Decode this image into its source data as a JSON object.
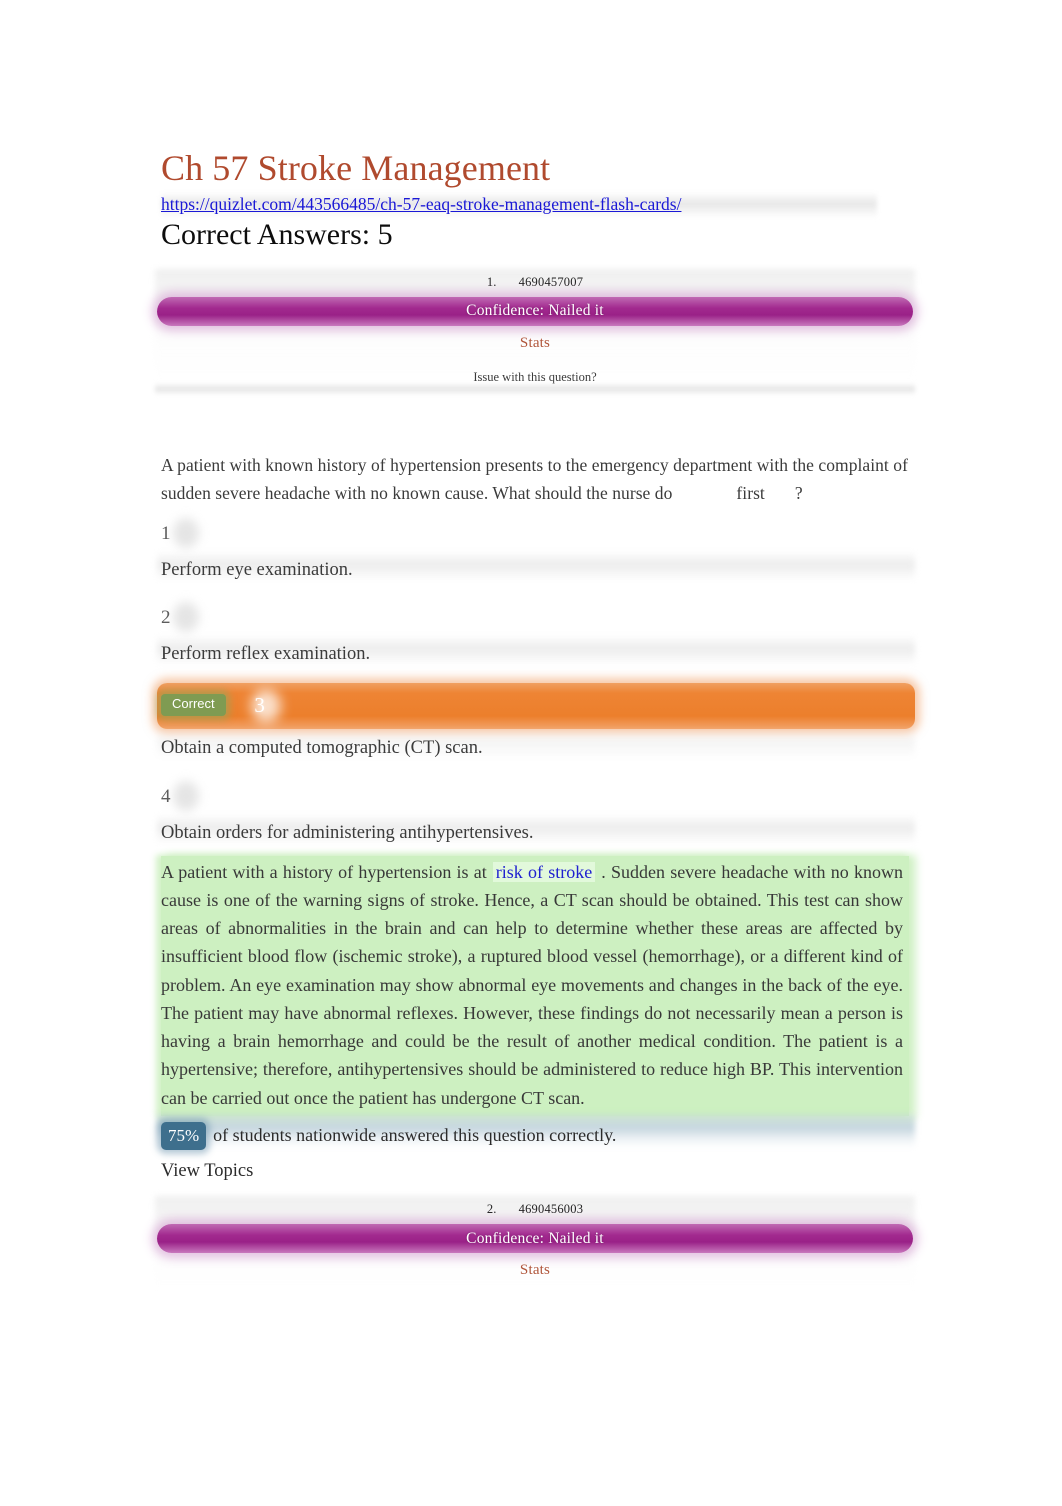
{
  "document": {
    "title": "Ch 57 Stroke Management",
    "url": "https://quizlet.com/443566485/ch-57-eaq-stroke-management-flash-cards/",
    "subtitle": "Correct Answers: 5",
    "title_color": "#b04a2e",
    "link_color": "#1a18d6"
  },
  "questions": [
    {
      "ordinal": "1.",
      "id": "4690457007",
      "confidence_label": "Confidence: Nailed it",
      "confidence_color": "#9a2187",
      "stats_link": "Stats",
      "issue_link": "Issue with this question?",
      "stem_part1": "A patient with known history of hypertension presents to the emergency department with the complaint of sudden severe headache with no known cause. What should the nurse do",
      "stem_emphasis": "first",
      "stem_part2": "?",
      "options": [
        {
          "number": "1",
          "text": "Perform eye examination.",
          "correct": false
        },
        {
          "number": "2",
          "text": "Perform reflex examination.",
          "correct": false
        },
        {
          "number": "3",
          "text": "Obtain a computed tomographic (CT) scan.",
          "correct": true,
          "badge": "Correct"
        },
        {
          "number": "4",
          "text": "Obtain orders for administering antihypertensives.",
          "correct": false
        }
      ],
      "rationale_part1": "A patient with a history of hypertension is at",
      "rationale_link": "risk of stroke",
      "rationale_part2": ". Sudden severe headache with no known cause is one of the warning signs of stroke. Hence, a CT scan should be obtained. This test can show areas of abnormalities in the brain and can help to determine whether these areas are affected by insufficient blood flow (ischemic stroke), a ruptured blood vessel (hemorrhage), or a different kind of problem. An eye examination may show abnormal eye movements and changes in the back of the eye. The patient may have abnormal reflexes. However, these findings do not necessarily mean a person is having a brain hemorrhage and could be the result of another medical condition. The patient is a hypertensive; therefore, antihypertensives should be administered to reduce high BP. This intervention can be carried out once the patient has undergone CT scan.",
      "rationale_bg": "#cdf0c1",
      "stats_percent": "75%",
      "stats_text": "of students nationwide answered this question correctly.",
      "view_topics": "View Topics"
    },
    {
      "ordinal": "2.",
      "id": "4690456003",
      "confidence_label": "Confidence: Nailed it",
      "stats_link": "Stats"
    }
  ]
}
